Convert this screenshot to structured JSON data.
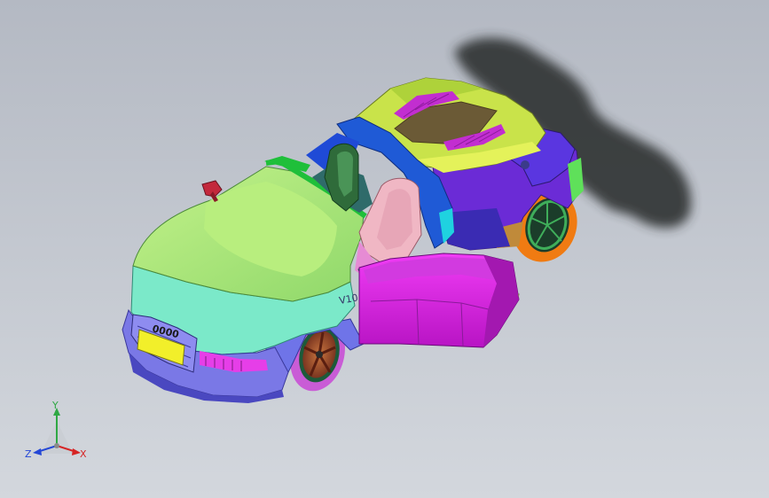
{
  "viewport": {
    "background_top": "#b4b9c3",
    "background_bottom": "#d3d7dd"
  },
  "triad": {
    "x_label": "X",
    "y_label": "Y",
    "z_label": "Z",
    "x_color": "#d62424",
    "y_color": "#2fa844",
    "z_color": "#2447d6"
  },
  "model": {
    "grille_logo_text": "0000",
    "badge_text": "V10",
    "colors": {
      "hood": "#9ee57a",
      "windshield_frame": "#1fbf3a",
      "front_bumper": "#7be9c9",
      "lower_fascia": "#7a78e6",
      "rear_deck": "#c9e34a",
      "rear_panels": "#6b2bd6",
      "door_outer": "#e61ef0",
      "seat_tan": "#f0b7c4",
      "rollbar": "#1f5ad6",
      "wheel_rim": "#a24b2a",
      "tire_front": "#c95cd6",
      "tire_rear": "#f07b12",
      "mirror": "#c3283c",
      "license_plate": "#f2ef2a",
      "shadow": "#2f3233"
    }
  }
}
